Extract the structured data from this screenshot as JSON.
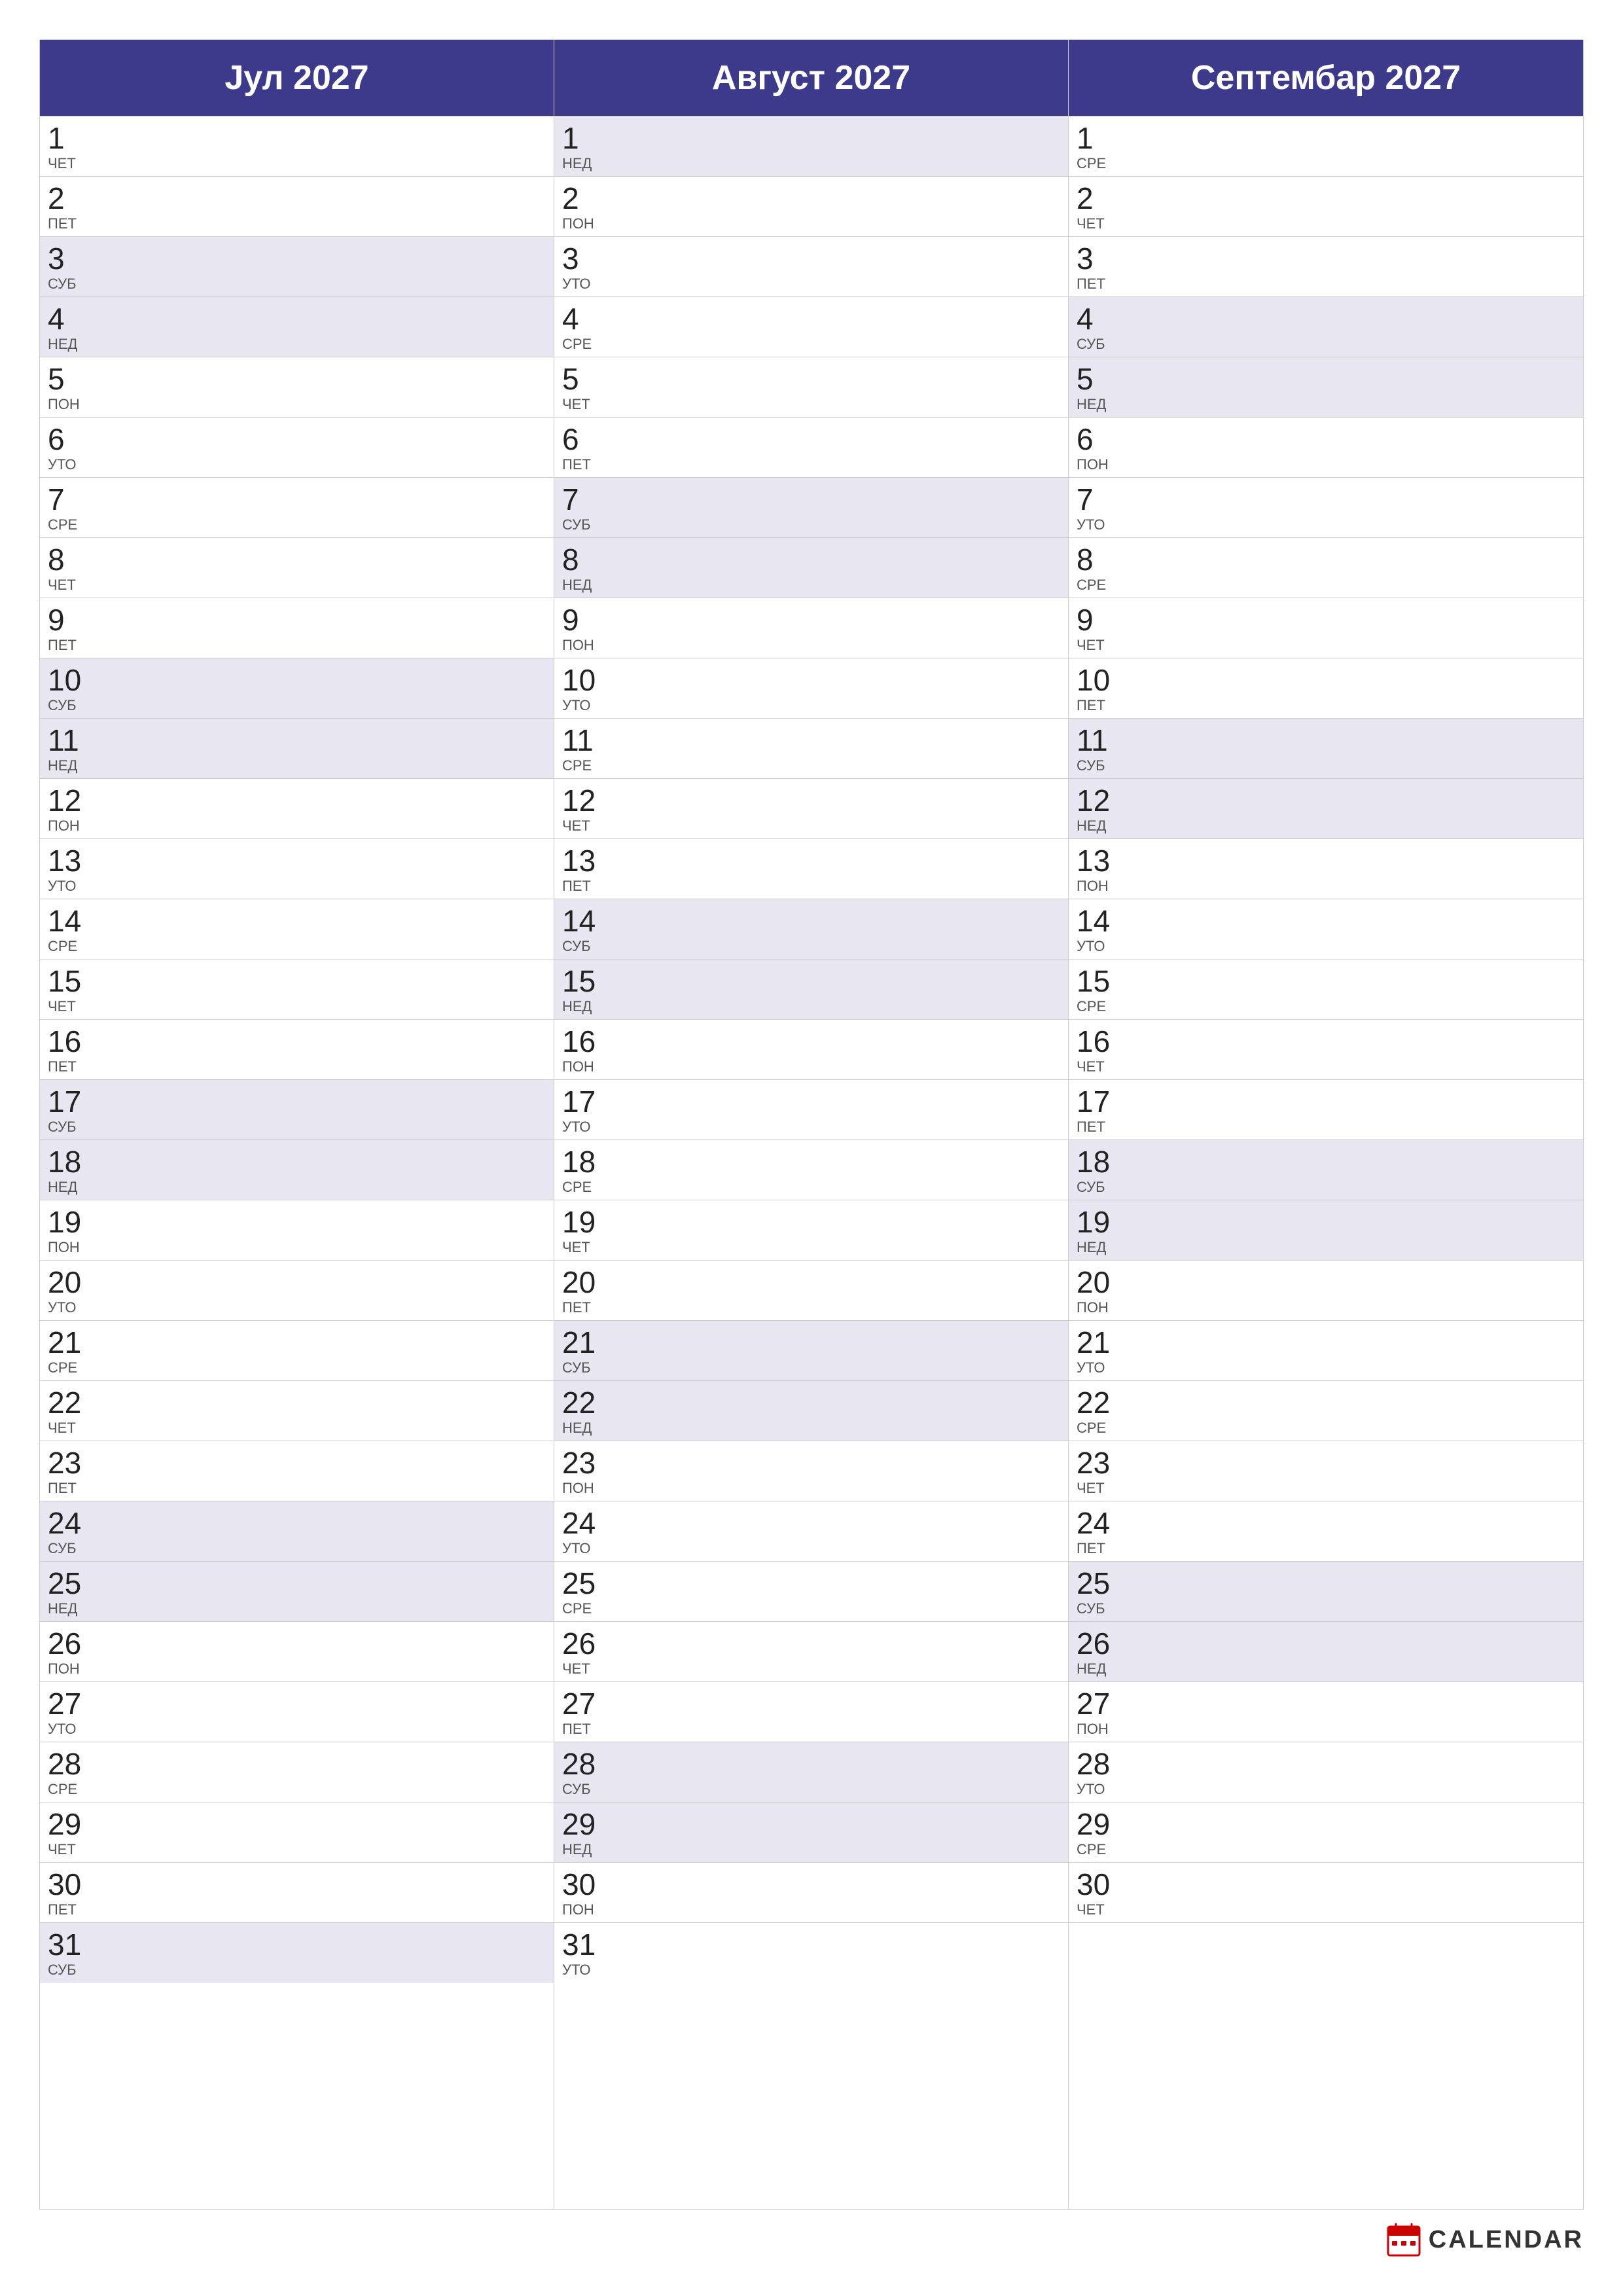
{
  "months": [
    {
      "name": "Јул 2027",
      "days": [
        {
          "num": 1,
          "name": "ЧЕТ",
          "weekend": false
        },
        {
          "num": 2,
          "name": "ПЕТ",
          "weekend": false
        },
        {
          "num": 3,
          "name": "СУБ",
          "weekend": true
        },
        {
          "num": 4,
          "name": "НЕД",
          "weekend": true
        },
        {
          "num": 5,
          "name": "ПОН",
          "weekend": false
        },
        {
          "num": 6,
          "name": "УТО",
          "weekend": false
        },
        {
          "num": 7,
          "name": "СРЕ",
          "weekend": false
        },
        {
          "num": 8,
          "name": "ЧЕТ",
          "weekend": false
        },
        {
          "num": 9,
          "name": "ПЕТ",
          "weekend": false
        },
        {
          "num": 10,
          "name": "СУБ",
          "weekend": true
        },
        {
          "num": 11,
          "name": "НЕД",
          "weekend": true
        },
        {
          "num": 12,
          "name": "ПОН",
          "weekend": false
        },
        {
          "num": 13,
          "name": "УТО",
          "weekend": false
        },
        {
          "num": 14,
          "name": "СРЕ",
          "weekend": false
        },
        {
          "num": 15,
          "name": "ЧЕТ",
          "weekend": false
        },
        {
          "num": 16,
          "name": "ПЕТ",
          "weekend": false
        },
        {
          "num": 17,
          "name": "СУБ",
          "weekend": true
        },
        {
          "num": 18,
          "name": "НЕД",
          "weekend": true
        },
        {
          "num": 19,
          "name": "ПОН",
          "weekend": false
        },
        {
          "num": 20,
          "name": "УТО",
          "weekend": false
        },
        {
          "num": 21,
          "name": "СРЕ",
          "weekend": false
        },
        {
          "num": 22,
          "name": "ЧЕТ",
          "weekend": false
        },
        {
          "num": 23,
          "name": "ПЕТ",
          "weekend": false
        },
        {
          "num": 24,
          "name": "СУБ",
          "weekend": true
        },
        {
          "num": 25,
          "name": "НЕД",
          "weekend": true
        },
        {
          "num": 26,
          "name": "ПОН",
          "weekend": false
        },
        {
          "num": 27,
          "name": "УТО",
          "weekend": false
        },
        {
          "num": 28,
          "name": "СРЕ",
          "weekend": false
        },
        {
          "num": 29,
          "name": "ЧЕТ",
          "weekend": false
        },
        {
          "num": 30,
          "name": "ПЕТ",
          "weekend": false
        },
        {
          "num": 31,
          "name": "СУБ",
          "weekend": true
        }
      ]
    },
    {
      "name": "Август 2027",
      "days": [
        {
          "num": 1,
          "name": "НЕД",
          "weekend": true
        },
        {
          "num": 2,
          "name": "ПОН",
          "weekend": false
        },
        {
          "num": 3,
          "name": "УТО",
          "weekend": false
        },
        {
          "num": 4,
          "name": "СРЕ",
          "weekend": false
        },
        {
          "num": 5,
          "name": "ЧЕТ",
          "weekend": false
        },
        {
          "num": 6,
          "name": "ПЕТ",
          "weekend": false
        },
        {
          "num": 7,
          "name": "СУБ",
          "weekend": true
        },
        {
          "num": 8,
          "name": "НЕД",
          "weekend": true
        },
        {
          "num": 9,
          "name": "ПОН",
          "weekend": false
        },
        {
          "num": 10,
          "name": "УТО",
          "weekend": false
        },
        {
          "num": 11,
          "name": "СРЕ",
          "weekend": false
        },
        {
          "num": 12,
          "name": "ЧЕТ",
          "weekend": false
        },
        {
          "num": 13,
          "name": "ПЕТ",
          "weekend": false
        },
        {
          "num": 14,
          "name": "СУБ",
          "weekend": true
        },
        {
          "num": 15,
          "name": "НЕД",
          "weekend": true
        },
        {
          "num": 16,
          "name": "ПОН",
          "weekend": false
        },
        {
          "num": 17,
          "name": "УТО",
          "weekend": false
        },
        {
          "num": 18,
          "name": "СРЕ",
          "weekend": false
        },
        {
          "num": 19,
          "name": "ЧЕТ",
          "weekend": false
        },
        {
          "num": 20,
          "name": "ПЕТ",
          "weekend": false
        },
        {
          "num": 21,
          "name": "СУБ",
          "weekend": true
        },
        {
          "num": 22,
          "name": "НЕД",
          "weekend": true
        },
        {
          "num": 23,
          "name": "ПОН",
          "weekend": false
        },
        {
          "num": 24,
          "name": "УТО",
          "weekend": false
        },
        {
          "num": 25,
          "name": "СРЕ",
          "weekend": false
        },
        {
          "num": 26,
          "name": "ЧЕТ",
          "weekend": false
        },
        {
          "num": 27,
          "name": "ПЕТ",
          "weekend": false
        },
        {
          "num": 28,
          "name": "СУБ",
          "weekend": true
        },
        {
          "num": 29,
          "name": "НЕД",
          "weekend": true
        },
        {
          "num": 30,
          "name": "ПОН",
          "weekend": false
        },
        {
          "num": 31,
          "name": "УТО",
          "weekend": false
        }
      ]
    },
    {
      "name": "Септембар 2027",
      "days": [
        {
          "num": 1,
          "name": "СРЕ",
          "weekend": false
        },
        {
          "num": 2,
          "name": "ЧЕТ",
          "weekend": false
        },
        {
          "num": 3,
          "name": "ПЕТ",
          "weekend": false
        },
        {
          "num": 4,
          "name": "СУБ",
          "weekend": true
        },
        {
          "num": 5,
          "name": "НЕД",
          "weekend": true
        },
        {
          "num": 6,
          "name": "ПОН",
          "weekend": false
        },
        {
          "num": 7,
          "name": "УТО",
          "weekend": false
        },
        {
          "num": 8,
          "name": "СРЕ",
          "weekend": false
        },
        {
          "num": 9,
          "name": "ЧЕТ",
          "weekend": false
        },
        {
          "num": 10,
          "name": "ПЕТ",
          "weekend": false
        },
        {
          "num": 11,
          "name": "СУБ",
          "weekend": true
        },
        {
          "num": 12,
          "name": "НЕД",
          "weekend": true
        },
        {
          "num": 13,
          "name": "ПОН",
          "weekend": false
        },
        {
          "num": 14,
          "name": "УТО",
          "weekend": false
        },
        {
          "num": 15,
          "name": "СРЕ",
          "weekend": false
        },
        {
          "num": 16,
          "name": "ЧЕТ",
          "weekend": false
        },
        {
          "num": 17,
          "name": "ПЕТ",
          "weekend": false
        },
        {
          "num": 18,
          "name": "СУБ",
          "weekend": true
        },
        {
          "num": 19,
          "name": "НЕД",
          "weekend": true
        },
        {
          "num": 20,
          "name": "ПОН",
          "weekend": false
        },
        {
          "num": 21,
          "name": "УТО",
          "weekend": false
        },
        {
          "num": 22,
          "name": "СРЕ",
          "weekend": false
        },
        {
          "num": 23,
          "name": "ЧЕТ",
          "weekend": false
        },
        {
          "num": 24,
          "name": "ПЕТ",
          "weekend": false
        },
        {
          "num": 25,
          "name": "СУБ",
          "weekend": true
        },
        {
          "num": 26,
          "name": "НЕД",
          "weekend": true
        },
        {
          "num": 27,
          "name": "ПОН",
          "weekend": false
        },
        {
          "num": 28,
          "name": "УТО",
          "weekend": false
        },
        {
          "num": 29,
          "name": "СРЕ",
          "weekend": false
        },
        {
          "num": 30,
          "name": "ЧЕТ",
          "weekend": false
        }
      ]
    }
  ],
  "brand": {
    "text": "CALENDAR",
    "icon_color": "#cc0000"
  }
}
